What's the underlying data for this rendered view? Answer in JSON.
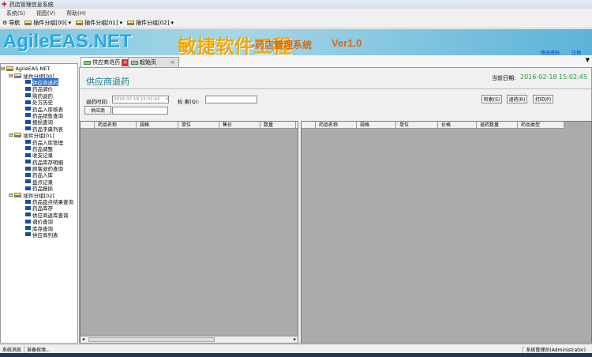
{
  "window": {
    "title": "药店管理信息系统"
  },
  "menu": [
    "系统(S)",
    "视图(V)",
    "帮助(H)"
  ],
  "toolbar": {
    "nav": "导航",
    "groups": [
      "插件分组[00]",
      "插件分组[01]",
      "插件分组[02]"
    ]
  },
  "banner": {
    "brand": "AgileEAS.NET",
    "cn": "敏捷软件工程",
    "sub": "-药店管理系统",
    "ver": "Ver1.0",
    "links": [
      "修改密码",
      "注销"
    ]
  },
  "tabs": [
    "供应商退药",
    "起始页"
  ],
  "tree": {
    "root": "AgileEAS.NET",
    "groups": [
      {
        "label": "插件分组[00]",
        "items": [
          "供应商退药",
          "药品调价",
          "购药退药",
          "处方历史",
          "药品入库核表",
          "药品销售查询",
          "报损查询",
          "药品字典列表"
        ]
      },
      {
        "label": "插件分组[01]",
        "items": [
          "药品入库管理",
          "药品调整",
          "收支记录",
          "药品库存明细",
          "顾客退药查询",
          "药品入库",
          "盘点记录",
          "药品报损"
        ]
      },
      {
        "label": "插件分组[02]",
        "items": [
          "药品盘点结果查询",
          "药品库存",
          "供应商返库查询",
          "调价查询",
          "库存查询",
          "供应商列表"
        ]
      }
    ]
  },
  "page": {
    "title": "供应商退药",
    "date_label": "当前日期:",
    "date_value": "2016-02-18 15:02:45",
    "return_time_label": "退药时间:",
    "return_time_value": "2016-02-18 15:02:43",
    "search_label": "检 索(Q):",
    "search_value": "",
    "supplier_button": "供应商",
    "supplier_value": "",
    "buttons": [
      "检索(S)",
      "退药(R)",
      "打印(P)"
    ],
    "left_columns": [
      "药品名称",
      "规格",
      "单位",
      "售价",
      "数量"
    ],
    "right_columns": [
      "药品名称",
      "规格",
      "单位",
      "价格",
      "退药数量",
      "药品类型"
    ]
  },
  "status": {
    "label": "系统消息",
    "message": "准备就绪...",
    "user": "系统管理员(Administrator)"
  }
}
